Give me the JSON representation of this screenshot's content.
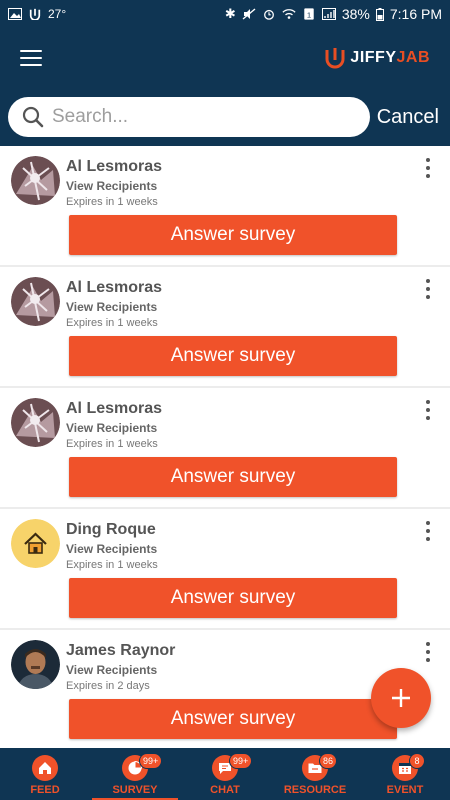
{
  "status_bar": {
    "temperature": "27°",
    "battery": "38%",
    "time": "7:16 PM"
  },
  "header": {
    "brand_part1": "JIFFY",
    "brand_part2": "JAB",
    "accent_color": "#f0522a",
    "bg_color": "#0f3553"
  },
  "search": {
    "placeholder": "Search...",
    "value": "",
    "cancel_label": "Cancel"
  },
  "surveys": [
    {
      "name": "Al Lesmoras",
      "recipients_label": "View Recipients",
      "expiry": "Expires in 1 weeks",
      "button_label": "Answer survey",
      "avatar": "abstract-avatar"
    },
    {
      "name": "Al Lesmoras",
      "recipients_label": "View Recipients",
      "expiry": "Expires in 1 weeks",
      "button_label": "Answer survey",
      "avatar": "abstract-avatar"
    },
    {
      "name": "Al Lesmoras",
      "recipients_label": "View Recipients",
      "expiry": "Expires in 1 weeks",
      "button_label": "Answer survey",
      "avatar": "abstract-avatar"
    },
    {
      "name": "Ding Roque",
      "recipients_label": "View Recipients",
      "expiry": "Expires in 1 weeks",
      "button_label": "Answer survey",
      "avatar": "house-avatar"
    },
    {
      "name": "James Raynor",
      "recipients_label": "View Recipients",
      "expiry": "Expires in 2 days",
      "button_label": "Answer survey",
      "avatar": "portrait-avatar"
    }
  ],
  "fab": {
    "icon": "plus-icon"
  },
  "bottom_nav": [
    {
      "label": "FEED",
      "badge": "",
      "icon": "home-icon",
      "active": false
    },
    {
      "label": "SURVEY",
      "badge": "99+",
      "icon": "pie-chart-icon",
      "active": true
    },
    {
      "label": "CHAT",
      "badge": "99+",
      "icon": "chat-icon",
      "active": false
    },
    {
      "label": "RESOURCE",
      "badge": "86",
      "icon": "folder-icon",
      "active": false
    },
    {
      "label": "EVENT",
      "badge": "8",
      "icon": "calendar-icon",
      "active": false
    }
  ]
}
